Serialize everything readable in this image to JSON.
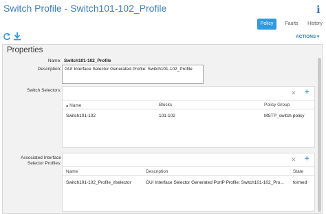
{
  "header": {
    "title": "Switch Profile - Switch101-102_Profile",
    "info_glyph": "i"
  },
  "tabs": [
    {
      "label": "Policy",
      "active": true
    },
    {
      "label": "Faults",
      "active": false
    },
    {
      "label": "History",
      "active": false
    }
  ],
  "toolbar": {
    "actions_label": "ACTIONS ▾",
    "icons": [
      "refresh-icon",
      "download-icon"
    ]
  },
  "properties": {
    "heading": "Properties",
    "name_label": "Name:",
    "name_value": "Switch101-102_Profile",
    "description_label": "Description:",
    "description_value": "GUI Interface Selector Generated Profile: Switch101-102_Profile"
  },
  "switch_selectors": {
    "label": "Switch Selectors:",
    "columns": [
      "▴ Name",
      "Blocks",
      "Policy Group"
    ],
    "rows": [
      [
        "Switch101-102",
        "101-102",
        "MSTP_switch-policy"
      ]
    ]
  },
  "interface_profiles": {
    "label_line1": "Associated Interface",
    "label_line2": "Selector Profiles:",
    "columns": [
      "Name",
      "Description",
      "State"
    ],
    "rows": [
      [
        "Switch101-102_Profile_ifselector",
        "GUI Interface Selector Generated PortP Profile: Switch101-102_Pro...",
        "formed"
      ]
    ]
  },
  "glyphs": {
    "close": "✕",
    "add": "+"
  },
  "colors": {
    "accent": "#2f9ae0",
    "title": "#3a7fc1",
    "panel_bg": "#f2f2f2"
  }
}
